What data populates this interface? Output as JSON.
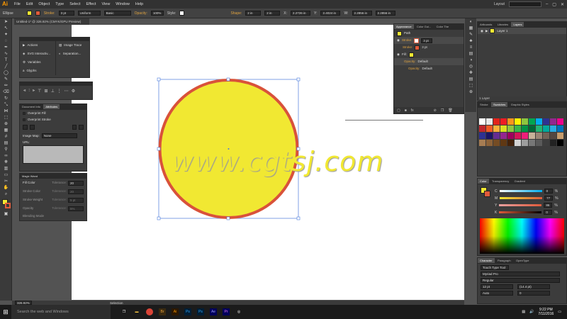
{
  "menubar": {
    "app_logo": "Ai",
    "items": [
      "File",
      "Edit",
      "Object",
      "Type",
      "Select",
      "Effect",
      "View",
      "Window",
      "Help"
    ],
    "workspace": "Layout",
    "colors": {
      "logo": "#ff9a00"
    }
  },
  "control_bar": {
    "selection_type": "Ellipse",
    "stroke_label": "Stroke:",
    "stroke_value": "3 pt",
    "stroke_profile": "Uniform",
    "brush": "Basic",
    "opacity_label": "Opacity:",
    "opacity_value": "100%",
    "style_label": "Style:",
    "shape_label": "Shape:",
    "w_value": "2 in",
    "h_value": "2 in",
    "x_label": "X:",
    "x_value": "2.2726 in",
    "y_label": "Y:",
    "y_value": "2.4024 in",
    "w2_label": "W:",
    "w2_value": "2.2856 in",
    "h2_value": "2.2856 in",
    "fill_color": "#f1e832",
    "stroke_color": "#e05a3a"
  },
  "document_tab": "Untitled-1* @ 326.92% (CMYK/GPU Preview)",
  "actions_panel": {
    "items": [
      "Actions",
      "SVG Interactiv...",
      "Variables",
      "Glyphs"
    ],
    "items_right": [
      "Image Trace",
      "Separation..."
    ]
  },
  "attributes_panel": {
    "tabs": [
      "Document Info",
      "Attributes"
    ],
    "overprint_fill": "Overprint Fill",
    "overprint_stroke": "Overprint Stroke",
    "image_map_label": "Image Map:",
    "image_map_value": "None",
    "url_label": "URL:"
  },
  "magic_wand": {
    "title": "Magic Wand",
    "rows": [
      {
        "label": "Fill Color",
        "tol_label": "Tolerance:",
        "tol": "20"
      },
      {
        "label": "Stroke Color",
        "tol_label": "Tolerance:",
        "tol": "20"
      },
      {
        "label": "Stroke Weight",
        "tol_label": "Tolerance:",
        "tol": "5 pt"
      },
      {
        "label": "Opacity",
        "tol_label": "Tolerance:",
        "tol": "5%"
      },
      {
        "label": "Blending Mode",
        "tol_label": "",
        "tol": ""
      }
    ]
  },
  "appearance_panel": {
    "tabs": [
      "Appearance",
      "Color Gui...",
      "Color The"
    ],
    "header": "Path",
    "stroke_label": "Stroke:",
    "stroke_value": "3 pt",
    "stroke_value2": "3 pt",
    "fill_label": "Fill:",
    "opacity_label": "Opacity:",
    "opacity_value": "Default",
    "opacity_label2": "Opacity:",
    "opacity_value2": "Default"
  },
  "layers_panel": {
    "tabs": [
      "Artboards",
      "Libraries",
      "Layers"
    ],
    "layer_name": "Layer 1",
    "footer": "1 Layer"
  },
  "swatches_panel": {
    "tabs": [
      "Stroke",
      "Swatches",
      "Graphic Styles"
    ],
    "rows": [
      [
        "#ffffff",
        "#e8e8e8",
        "#e2231a",
        "#ed1c24",
        "#f7941d",
        "#fff200",
        "#8dc63f",
        "#00a651",
        "#00aeef",
        "#2e3192",
        "#92278f",
        "#ec008c"
      ],
      [
        "#c1272d",
        "#f15a24",
        "#fbb03b",
        "#d9e021",
        "#8cc63f",
        "#39b54a",
        "#009245",
        "#006837",
        "#22b573",
        "#00a99d",
        "#29abe2",
        "#0071bc"
      ],
      [
        "#2e3192",
        "#1b1464",
        "#662d91",
        "#93278f",
        "#9e005d",
        "#d4145a",
        "#ed1e79",
        "#c7b299",
        "#998675",
        "#736357",
        "#534741",
        "#c69c6d"
      ],
      [
        "#a67c52",
        "#8c6239",
        "#754c24",
        "#603813",
        "#42210b",
        "#d3d3d3",
        "#9e9e9e",
        "#777777",
        "#5a5a5a",
        "#3e3e3e",
        "#222222",
        "#000000"
      ]
    ]
  },
  "color_panel": {
    "tabs": [
      "Color",
      "Transparency",
      "Gradient"
    ],
    "c_value": "0",
    "m_value": "77",
    "y_value": "86",
    "k_value": "0",
    "c_label": "C",
    "m_label": "M",
    "y_label": "Y",
    "k_label": "K",
    "pct": "%"
  },
  "character_panel": {
    "tabs": [
      "Character",
      "Paragraph",
      "OpenType"
    ],
    "search_placeholder": "Touch Type Tool",
    "font": "Myriad Pro",
    "style": "Regular",
    "size": "12 pt",
    "leading": "(14.4 pt)",
    "tracking": "Auto",
    "kerning": "0"
  },
  "watermark": "www.cgtsj.com",
  "status_bar": {
    "zoom": "326.92%",
    "tool": "Selection"
  },
  "taskbar": {
    "search_placeholder": "Search the web and Windows",
    "time": "9:22 PM",
    "date": "7/11/2016",
    "apps": [
      "Ps",
      "Br",
      "Ai",
      "Ps",
      "Ps",
      "Ae",
      "Pr"
    ]
  }
}
